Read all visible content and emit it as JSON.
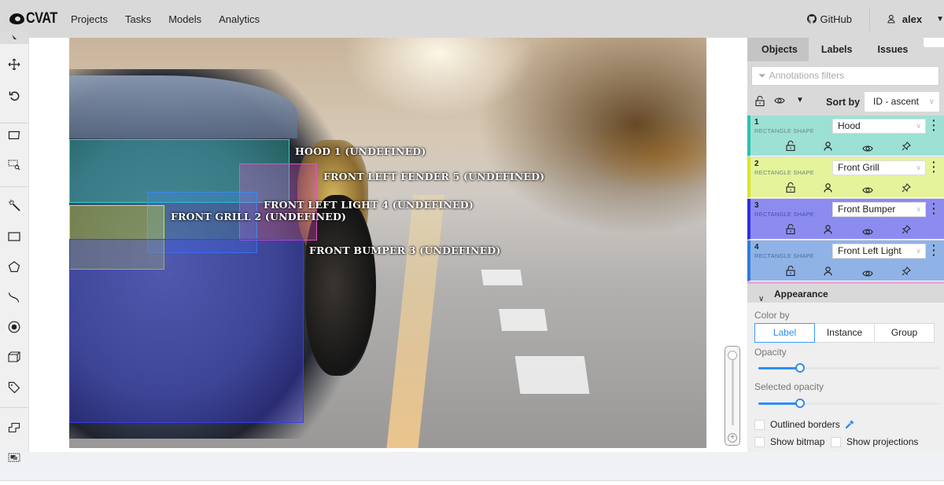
{
  "app": {
    "logo": "CVAT",
    "nav": [
      "Projects",
      "Tasks",
      "Models",
      "Analytics"
    ],
    "github_label": "GitHub",
    "user_name": "alex"
  },
  "toolbar": {
    "tools": [
      "cursor",
      "move",
      "rotate",
      "fit-image",
      "zoom-region",
      "magic-wand",
      "rectangle",
      "polygon",
      "polyline",
      "points",
      "cuboid",
      "tag",
      "merge",
      "group"
    ]
  },
  "canvas": {
    "annotations": [
      {
        "id": 1,
        "label": "Hood",
        "caption": "HOOD 1 (UNDEFINED)",
        "color": "#2fd4c0"
      },
      {
        "id": 5,
        "label": "Front Left Fender",
        "caption": "FRONT LEFT FENDER 5 (UNDEFINED)",
        "color": "#e052c8"
      },
      {
        "id": 4,
        "label": "Front Left Light",
        "caption": "FRONT LEFT LIGHT 4 (UNDEFINED)",
        "color": "#3a86f0"
      },
      {
        "id": 2,
        "label": "Front Grill",
        "caption": "FRONT GRILL 2 (UNDEFINED)",
        "color": "#d8e62a"
      },
      {
        "id": 3,
        "label": "Front Bumper",
        "caption": "FRONT BUMPER 3 (UNDEFINED)",
        "color": "#3b3bf0"
      }
    ],
    "zoom_plus": "+"
  },
  "sidebar": {
    "tabs": [
      "Objects",
      "Labels",
      "Issues"
    ],
    "active_tab": "Objects",
    "filter_placeholder": "Annotations filters",
    "sort_label": "Sort by",
    "sort_value": "ID - ascent",
    "objects": [
      {
        "id": "1",
        "type": "RECTANGLE SHAPE",
        "label": "Hood",
        "bg": "#9de0d4",
        "bar": "#27c2ae"
      },
      {
        "id": "2",
        "type": "RECTANGLE SHAPE",
        "label": "Front Grill",
        "bg": "#e5f39a",
        "bar": "#d8e62a"
      },
      {
        "id": "3",
        "type": "RECTANGLE SHAPE",
        "label": "Front Bumper",
        "bg": "#8c8cf0",
        "bar": "#2e2ee6"
      },
      {
        "id": "4",
        "type": "RECTANGLE SHAPE",
        "label": "Front Left Light",
        "bg": "#8fb3e6",
        "bar": "#2f7ae0"
      }
    ],
    "appearance": {
      "title": "Appearance",
      "color_by_label": "Color by",
      "color_by_options": [
        "Label",
        "Instance",
        "Group"
      ],
      "color_by_selected": "Label",
      "opacity_label": "Opacity",
      "opacity_value": 0.22,
      "selected_opacity_label": "Selected opacity",
      "selected_opacity_value": 0.22,
      "outlined_borders_label": "Outlined borders",
      "outlined_borders_checked": false,
      "show_bitmap_label": "Show bitmap",
      "show_bitmap_checked": false,
      "show_projections_label": "Show projections",
      "show_projections_checked": false
    }
  }
}
